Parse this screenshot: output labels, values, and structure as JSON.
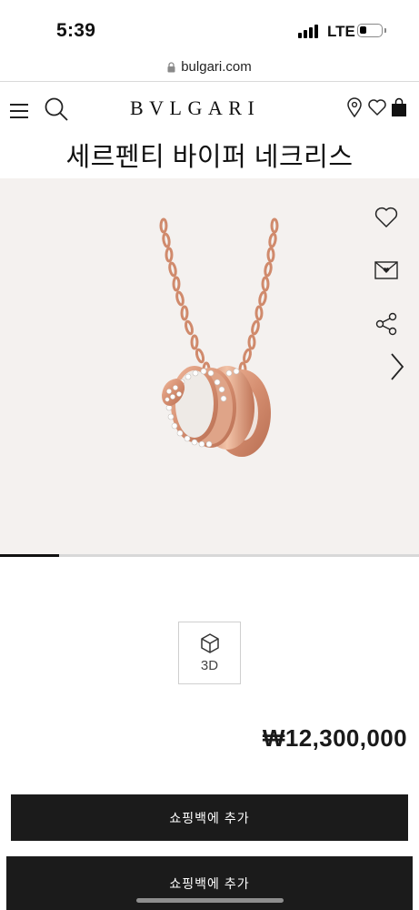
{
  "status_bar": {
    "time": "5:39",
    "network": "LTE"
  },
  "browser": {
    "url": "bulgari.com"
  },
  "header": {
    "logo": "BVLGARI"
  },
  "product": {
    "title": "세르펜티 바이퍼 네크리스",
    "view_3d_label": "3D",
    "price": "₩12,300,000"
  },
  "gallery": {
    "progress": 0.14
  },
  "actions": {
    "add_to_bag_label": "쇼핑백에 추가",
    "add_to_bag_sticky_label": "쇼핑백에 추가"
  },
  "colors": {
    "gallery_bg": "#f4f1ef",
    "button_bg": "#1b1b1b",
    "rose_gold": "#d9967a"
  },
  "icons": [
    "menu-icon",
    "search-icon",
    "location-pin-icon",
    "heart-icon",
    "shopping-bag-icon",
    "wishlist-heart-icon",
    "envelope-icon",
    "share-icon",
    "chevron-right-icon",
    "cube-icon",
    "lock-icon"
  ]
}
